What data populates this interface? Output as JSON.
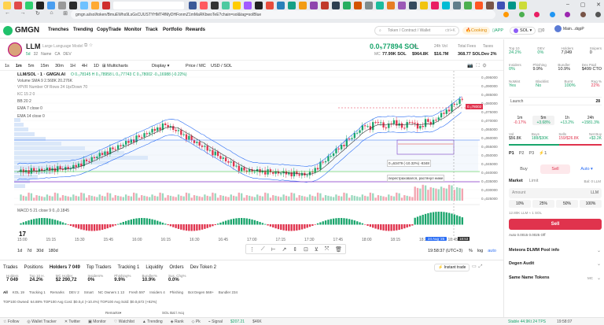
{
  "browser": {
    "url": "gmgn.ai/sol/token/BmuEWhs9LsGsCUUSTYHMT4fMyDHFonmZ1mMaRKbwoTeE?chain=sol&tag=solBlue",
    "url_display": "gmgn.ai/sol/token/BmuEWhs9LsGsCUUSTYHMT4fMyDHFonmZ1mMaRKbwoTeE?chain=sol&tag=solBlue"
  },
  "nav": {
    "logo": "GMGN",
    "items": [
      "Trenches",
      "Trending",
      "CopyTrade",
      "Monitor",
      "Track",
      "Portfolio",
      "Rewards"
    ],
    "search_placeholder": "Token / Contract / Wallet",
    "search_shortcut": "ctrl+K",
    "cooking": "Cooking",
    "app": "APP",
    "chain": "SOL",
    "balance": "0",
    "account": "Main...dqpP"
  },
  "token": {
    "symbol": "LLM",
    "name": "Large Language Model",
    "age": "5d",
    "holders_badge": "32",
    "tags": [
      "Name",
      "CA",
      "DEV"
    ],
    "price": "0.0₅77894 SOL",
    "mc_label": "MC",
    "mc": "77.99K SOL",
    "stats": [
      {
        "label": "Liq",
        "value": "$964.8K"
      },
      {
        "label": "24h Vol",
        "value": "$16.7M"
      },
      {
        "label": "Total Fees",
        "value": "368.77 SOL"
      },
      {
        "label": "Taxes",
        "value": "Dev 2%"
      }
    ]
  },
  "chart_toolbar": {
    "intervals": [
      "1s",
      "1m",
      "5m",
      "15m",
      "30m",
      "1H",
      "4H",
      "1D"
    ],
    "active": "1m",
    "multicharts": "Multicharts",
    "display": "Display",
    "price_mc": "Price / MC",
    "usd_sol": "USD / SOL"
  },
  "chart": {
    "legend_title": "LLM/SOL · 1 · GMGN.AI",
    "ohlc": "O 0.₅78145 H 0.₅78958 L 0.₅77743 C 0.₅78002 -0.₆16988 (-0.22%)",
    "indicators": [
      "Volume SMA 9 2.568K 20.276K",
      "VPVR Number Of Rows 24 Up/Down 70",
      "KC 15 2 0",
      "BB 20 2",
      "EMA 7 close 0",
      "EMA 14 close 0"
    ],
    "macd": "MACD 5 21 close 9 0.₀0.1845",
    "annotation_value": "0.₅63479 (-10.32%) -8348",
    "annotation_note": "перестраховался, растянул ниже",
    "time_labels": [
      "15:00",
      "15:15",
      "15:30",
      "15:45",
      "16:00",
      "16:15",
      "16:30",
      "16:45",
      "17:00",
      "17:15",
      "17:30",
      "17:45",
      "18:00",
      "18:15",
      "18:30",
      "18:45"
    ],
    "date_badge": "24 Aug '25",
    "time_badge": "18:53",
    "price_labels": [
      "0.₅095000",
      "0.₅090000",
      "0.₅085000",
      "0.₅080000",
      "0.₅075000",
      "0.₅070000",
      "0.₅065000",
      "0.₅060000",
      "0.₅055000",
      "0.₅050000",
      "0.₅045000",
      "0.₅040000",
      "0.₅035000",
      "0.₅030000",
      "0.₅025000"
    ],
    "current_price_tag": "0.₅78002",
    "ranges": [
      "1d",
      "7d",
      "30d",
      "180d"
    ],
    "clock": "19:58:37 (UTC+3)",
    "pct_btn": "%",
    "log_btn": "log",
    "auto_btn": "auto"
  },
  "bottom": {
    "tabs": [
      "Trades",
      "Positions",
      "Holders 7 049",
      "Top Traders",
      "Tracking 1",
      "Liquidity",
      "Orders",
      "Dev Token 2"
    ],
    "instant_trade": "Instant trade",
    "holder_stats": [
      {
        "label": "Holders",
        "value": "7 049"
      },
      {
        "label": "Top 10 H.",
        "value": "24.2%"
      },
      {
        "label": "MC Holder",
        "value": "$2 290,72"
      },
      {
        "label": "Insiders%",
        "value": "0%"
      },
      {
        "label": "Phishing%",
        "value": "9.9%"
      },
      {
        "label": "Bundler%",
        "value": "10.9%"
      },
      {
        "label": "Sus. Chg%",
        "value": "0.0%"
      }
    ],
    "filters": [
      "All",
      "KOL 19",
      "Tracking 1",
      "Remarks",
      "DEV 2",
      "Smart",
      "NC Owners 1 13",
      "Fresh 597",
      "Insiders 4",
      "Phishing",
      "Bot Degen 568+",
      "Bundler 234"
    ],
    "footer": "TOP100 Owned: 64.88%   TOP100 Avg Cost: $0.0₅4 (+10.4%)   TOP100 Avg Sold: $0.0₅572 (+82%)",
    "remarks_label": "Remarks▾",
    "sol_bal": "SOL Bal / Acq"
  },
  "right": {
    "metrics_row1": [
      {
        "label": "Top 10",
        "value": "24.2%"
      },
      {
        "label": "DEV",
        "value": "0%"
      },
      {
        "label": "Holders",
        "value": "7,049"
      },
      {
        "label": "Snipers",
        "value": "0"
      }
    ],
    "metrics_row2": [
      {
        "label": "Insiders",
        "value": "0%"
      },
      {
        "label": "Phishing",
        "value": "9.9%"
      },
      {
        "label": "Bundler",
        "value": "10.9%"
      },
      {
        "label": "Dex Paid",
        "value": "$499 CTO"
      }
    ],
    "metrics_row3": [
      {
        "label": "NoMint",
        "value": "Yes"
      },
      {
        "label": "Blacklist",
        "value": "No"
      },
      {
        "label": "Burnt",
        "value": "100%"
      },
      {
        "label": "Rug %",
        "value": "22%"
      }
    ],
    "launch": "Launch",
    "launch_count": "28",
    "tf_labels": [
      "1m",
      "5m",
      "1h",
      "24h"
    ],
    "tf_values": [
      "-0.17%",
      "+3.68%",
      "+13.2%",
      "+1581.3%"
    ],
    "vol_label": "Vol",
    "vol": "$56.8K",
    "buys_label": "Buys",
    "buys": "188/$30K",
    "sells_label": "Sells",
    "sells": "159/$26.8K",
    "netbuy_label": "Net Buy",
    "netbuy": "+$3.2K",
    "presets": [
      "P1",
      "P2",
      "P3"
    ],
    "preset_sel": "1",
    "buy": "Buy",
    "sell": "Sell",
    "auto": "Auto",
    "market": "Market",
    "limit": "Limit",
    "bal": "Bal: 0 LLM",
    "amount_label": "Amount",
    "amount_unit": "LLM",
    "pct": [
      "10%",
      "25%",
      "50%",
      "100%"
    ],
    "receive": "12.80K LLM ≈ 1 SOL",
    "sell_btn": "Sell",
    "auto_fees": "Auto   0.0015   0.0025   Off",
    "pool_info": "Meteora DLMM Pool info",
    "degen_audit": "Degen Audit",
    "same_name": "Same Name Tokens",
    "same_name_tag": "MC"
  },
  "statusbar": {
    "items": [
      "Follow",
      "Wallet Tracker",
      "Twitter",
      "Monitor",
      "Watchlist",
      "Trending",
      "Rank",
      "Pk",
      "Signal"
    ],
    "sol_price": "$207.21",
    "mode": "$46K",
    "stable": "Stable 44.9Kt  24 TPS",
    "time": "19:58:07"
  }
}
